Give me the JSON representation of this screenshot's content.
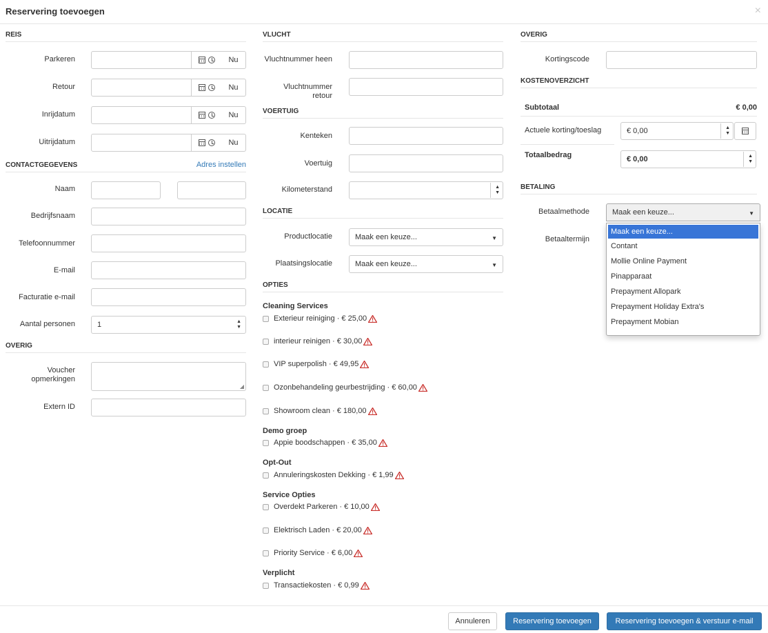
{
  "modal": {
    "title": "Reservering toevoegen",
    "close": "×"
  },
  "reis": {
    "heading": "REIS",
    "fields": [
      {
        "label": "Parkeren",
        "now": "Nu"
      },
      {
        "label": "Retour",
        "now": "Nu"
      },
      {
        "label": "Inrijdatum",
        "now": "Nu"
      },
      {
        "label": "Uitrijdatum",
        "now": "Nu"
      }
    ]
  },
  "contact": {
    "heading": "CONTACTGEGEVENS",
    "link": "Adres instellen",
    "naam": "Naam",
    "bedrijfsnaam": "Bedrijfsnaam",
    "telefoon": "Telefoonnummer",
    "email": "E-mail",
    "factuur_email": "Facturatie e-mail",
    "aantal_personen": "Aantal personen",
    "aantal_personen_value": "1"
  },
  "overig_left": {
    "heading": "OVERIG",
    "voucher_label_1": "Voucher",
    "voucher_label_2": "opmerkingen",
    "extern_id": "Extern ID"
  },
  "vlucht": {
    "heading": "VLUCHT",
    "heen": "Vluchtnummer heen",
    "retour_1": "Vluchtnummer",
    "retour_2": "retour"
  },
  "voertuig": {
    "heading": "VOERTUIG",
    "kenteken": "Kenteken",
    "voertuig": "Voertuig",
    "kilometerstand": "Kilometerstand"
  },
  "locatie": {
    "heading": "LOCATIE",
    "product": "Productlocatie",
    "product_value": "Maak een keuze...",
    "plaatsing": "Plaatsingslocatie",
    "plaatsing_value": "Maak een keuze..."
  },
  "opties": {
    "heading": "OPTIES",
    "groups": [
      {
        "title": "Cleaning Services",
        "items": [
          "Exterieur reiniging · € 25,00",
          "interieur reinigen · € 30,00",
          "VIP superpolish · € 49,95",
          "Ozonbehandeling geurbestrijding · € 60,00",
          "Showroom clean · € 180,00"
        ]
      },
      {
        "title": "Demo groep",
        "items": [
          "Appie boodschappen · € 35,00"
        ]
      },
      {
        "title": "Opt-Out",
        "items": [
          "Annuleringskosten Dekking · € 1,99"
        ]
      },
      {
        "title": "Service Opties",
        "items": [
          "Overdekt Parkeren · € 10,00",
          "Elektrisch Laden · € 20,00",
          "Priority Service · € 6,00"
        ]
      },
      {
        "title": "Verplicht",
        "items": [
          "Transactiekosten · € 0,99"
        ]
      }
    ]
  },
  "overig_right": {
    "heading": "OVERIG",
    "kortingscode": "Kortingscode"
  },
  "kosten": {
    "heading": "KOSTENOVERZICHT",
    "subtotaal": "Subtotaal",
    "subtotaal_value": "€ 0,00",
    "korting": "Actuele korting/toeslag",
    "korting_value": "€ 0,00",
    "totaal": "Totaalbedrag",
    "totaal_value": "€ 0,00"
  },
  "betaling": {
    "heading": "BETALING",
    "methode": "Betaalmethode",
    "methode_value": "Maak een keuze...",
    "termijn": "Betaaltermijn",
    "options": [
      "Maak een keuze...",
      "Contant",
      "Mollie Online Payment",
      "Pinapparaat",
      "Prepayment Allopark",
      "Prepayment Holiday Extra's",
      "Prepayment Mobian"
    ]
  },
  "footer": {
    "cancel": "Annuleren",
    "add": "Reservering toevoegen",
    "add_mail": "Reservering toevoegen & verstuur e-mail"
  },
  "colors": {
    "primary": "#337ab7",
    "warning": "#c9302c",
    "dropdown_active": "#3875d7"
  }
}
